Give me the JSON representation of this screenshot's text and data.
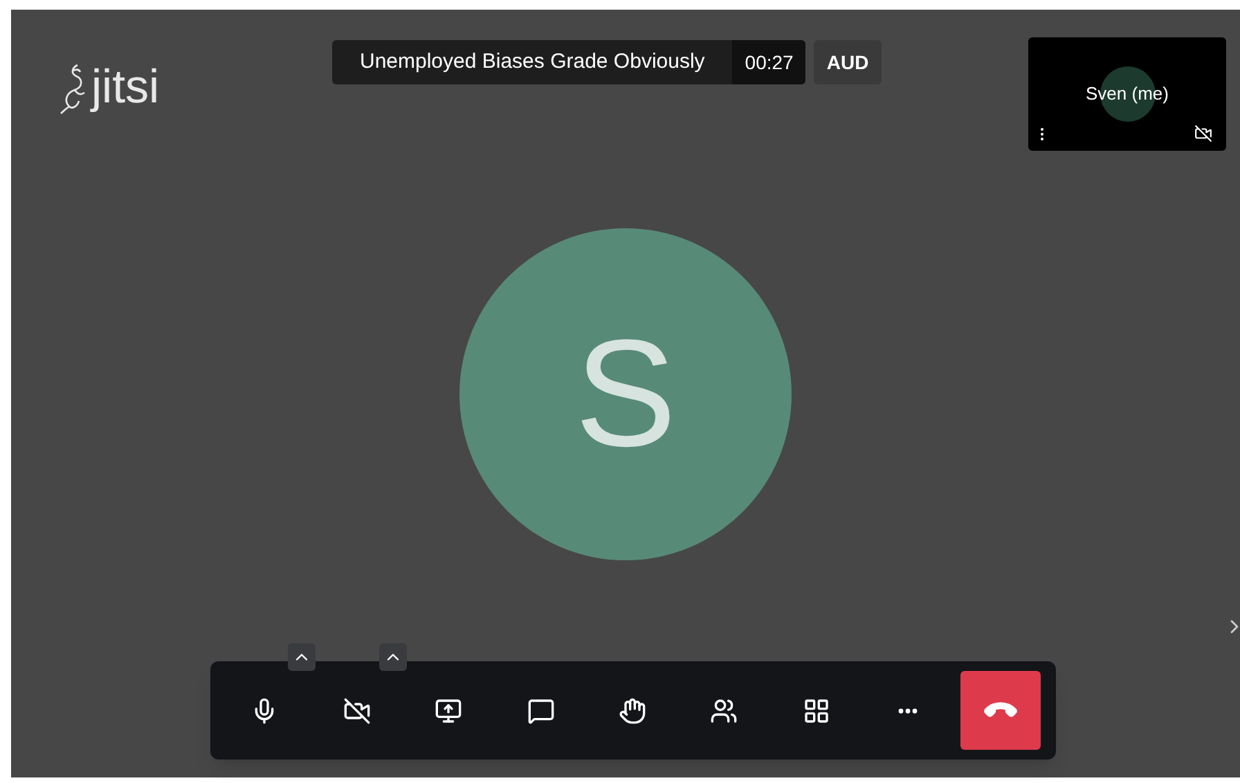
{
  "logo": {
    "text": "jitsi"
  },
  "meeting": {
    "title": "Unemployed Biases Grade Obviously",
    "timer": "00:27",
    "badge": "AUD"
  },
  "self_view": {
    "name": "Sven (me)",
    "camera_muted": true
  },
  "speaker": {
    "initial": "S"
  },
  "toolbar": [
    {
      "kind": "mic",
      "muted": false,
      "options": true
    },
    {
      "kind": "camera",
      "muted": true,
      "options": true
    },
    {
      "kind": "share",
      "options": false
    },
    {
      "kind": "chat",
      "options": false
    },
    {
      "kind": "hand",
      "options": false
    },
    {
      "kind": "participants",
      "options": false
    },
    {
      "kind": "tiles",
      "options": false
    },
    {
      "kind": "more",
      "options": false
    },
    {
      "kind": "hangup",
      "options": false
    }
  ]
}
